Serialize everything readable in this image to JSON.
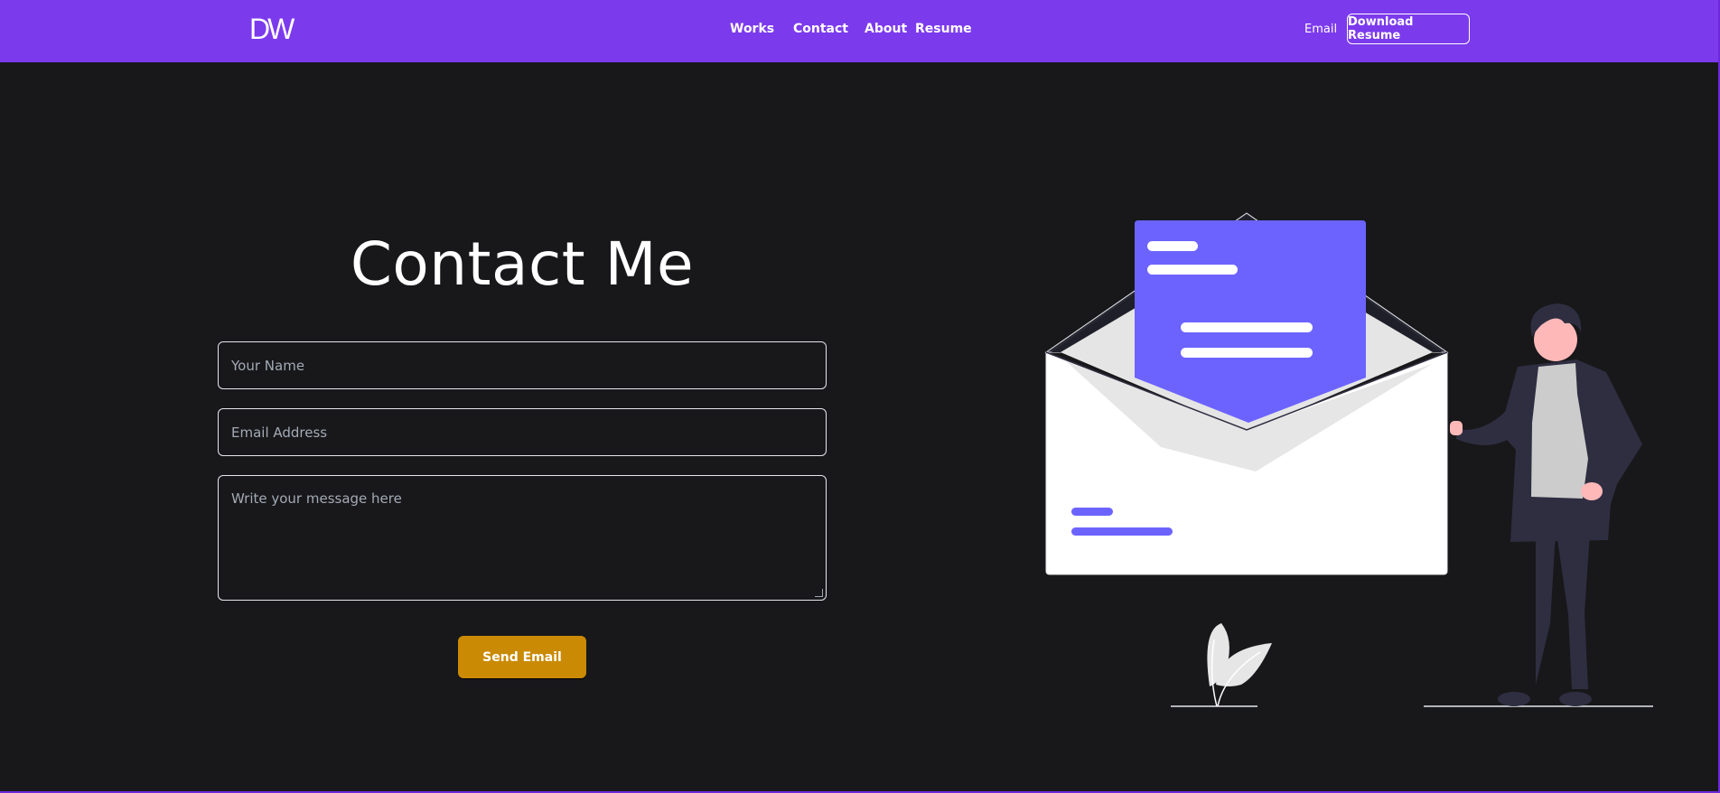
{
  "header": {
    "logo": "DW",
    "nav": [
      {
        "label": "Works"
      },
      {
        "label": "Contact"
      },
      {
        "label": "About"
      },
      {
        "label": "Resume"
      }
    ],
    "email_label": "Email",
    "download_label": "Download Resume"
  },
  "contact": {
    "title": "Contact Me",
    "name_placeholder": "Your Name",
    "email_placeholder": "Email Address",
    "message_placeholder": "Write your message here",
    "send_label": "Send Email"
  },
  "colors": {
    "brand": "#7c3aed",
    "background": "#18181b",
    "accent": "#ca8a04",
    "illustration_primary": "#6c63ff"
  }
}
